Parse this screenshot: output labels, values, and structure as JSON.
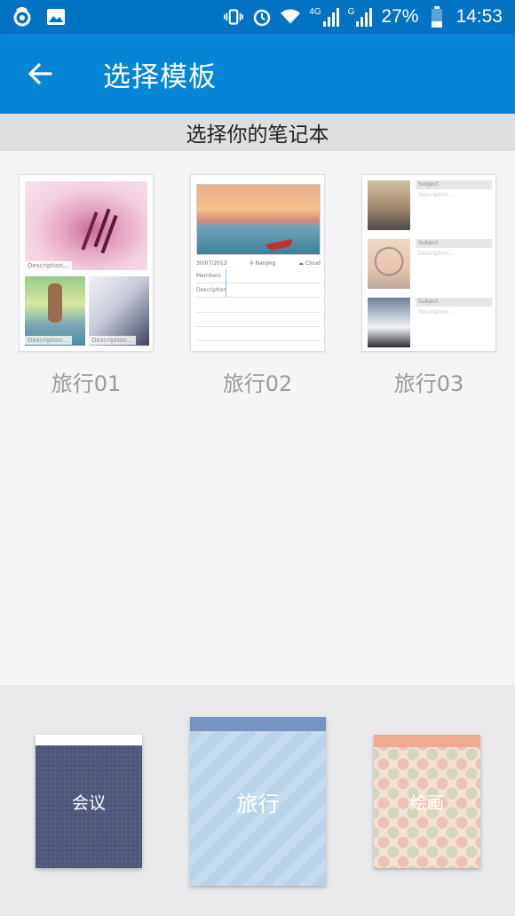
{
  "status_bar": {
    "network_label": "4G",
    "signal2_label": "G",
    "battery": "27%",
    "time": "14:53"
  },
  "app_bar": {
    "title": "选择模板"
  },
  "section": {
    "title": "选择你的笔记本"
  },
  "templates": [
    {
      "label": "旅行01"
    },
    {
      "label": "旅行02"
    },
    {
      "label": "旅行03"
    }
  ],
  "template_text": {
    "description": "Description...",
    "date": "30/07/2013",
    "location": "Nanjing",
    "weather": "Cloud",
    "members": "Members",
    "desc_field": "Description",
    "subject": "Subject"
  },
  "notebooks": [
    {
      "label": "会议"
    },
    {
      "label": "旅行"
    },
    {
      "label": "绘画"
    }
  ]
}
